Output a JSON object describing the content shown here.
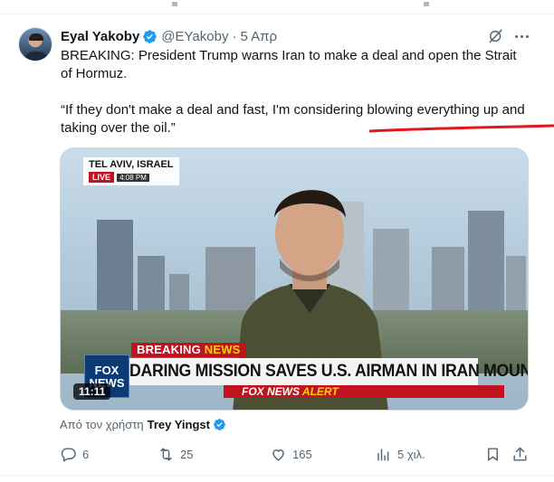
{
  "tweet": {
    "author_name": "Eyal Yakoby",
    "handle": "@EYakoby",
    "separator": "·",
    "date": "5 Απρ",
    "text_p1": "BREAKING: President Trump warns Iran to make a deal and open the Strait of Hormuz.",
    "text_p2": "“If they don't make a deal and fast, I'm considering blowing everything up and taking over the oil.”"
  },
  "media": {
    "location_tag": "TEL AVIV, ISRAEL",
    "live_label": "LIVE",
    "live_time": "4:08 PM",
    "breaking_word": "BREAKING",
    "breaking_news_word": "NEWS",
    "headline": "DARING MISSION SAVES U.S. AIRMAN IN IRAN MOUNTAINS",
    "alert_brand": "FOX NEWS",
    "alert_word": "ALERT",
    "logo_line1": "FOX",
    "logo_line2": "NEWS",
    "duration": "11:11"
  },
  "attribution": {
    "prefix": "Από τον χρήστη",
    "name": "Trey Yingst"
  },
  "actions": {
    "replies": "6",
    "reposts": "25",
    "likes": "165",
    "views": "5 χιλ."
  },
  "colors": {
    "verified_blue": "#1d9bf0",
    "text_secondary": "#536471",
    "annotation_red": "#e0161b",
    "fox_red": "#c1121f"
  },
  "icons": [
    "verified-badge-icon",
    "grok-icon",
    "more-icon",
    "reply-icon",
    "repost-icon",
    "like-icon",
    "views-icon",
    "bookmark-icon",
    "share-icon"
  ]
}
